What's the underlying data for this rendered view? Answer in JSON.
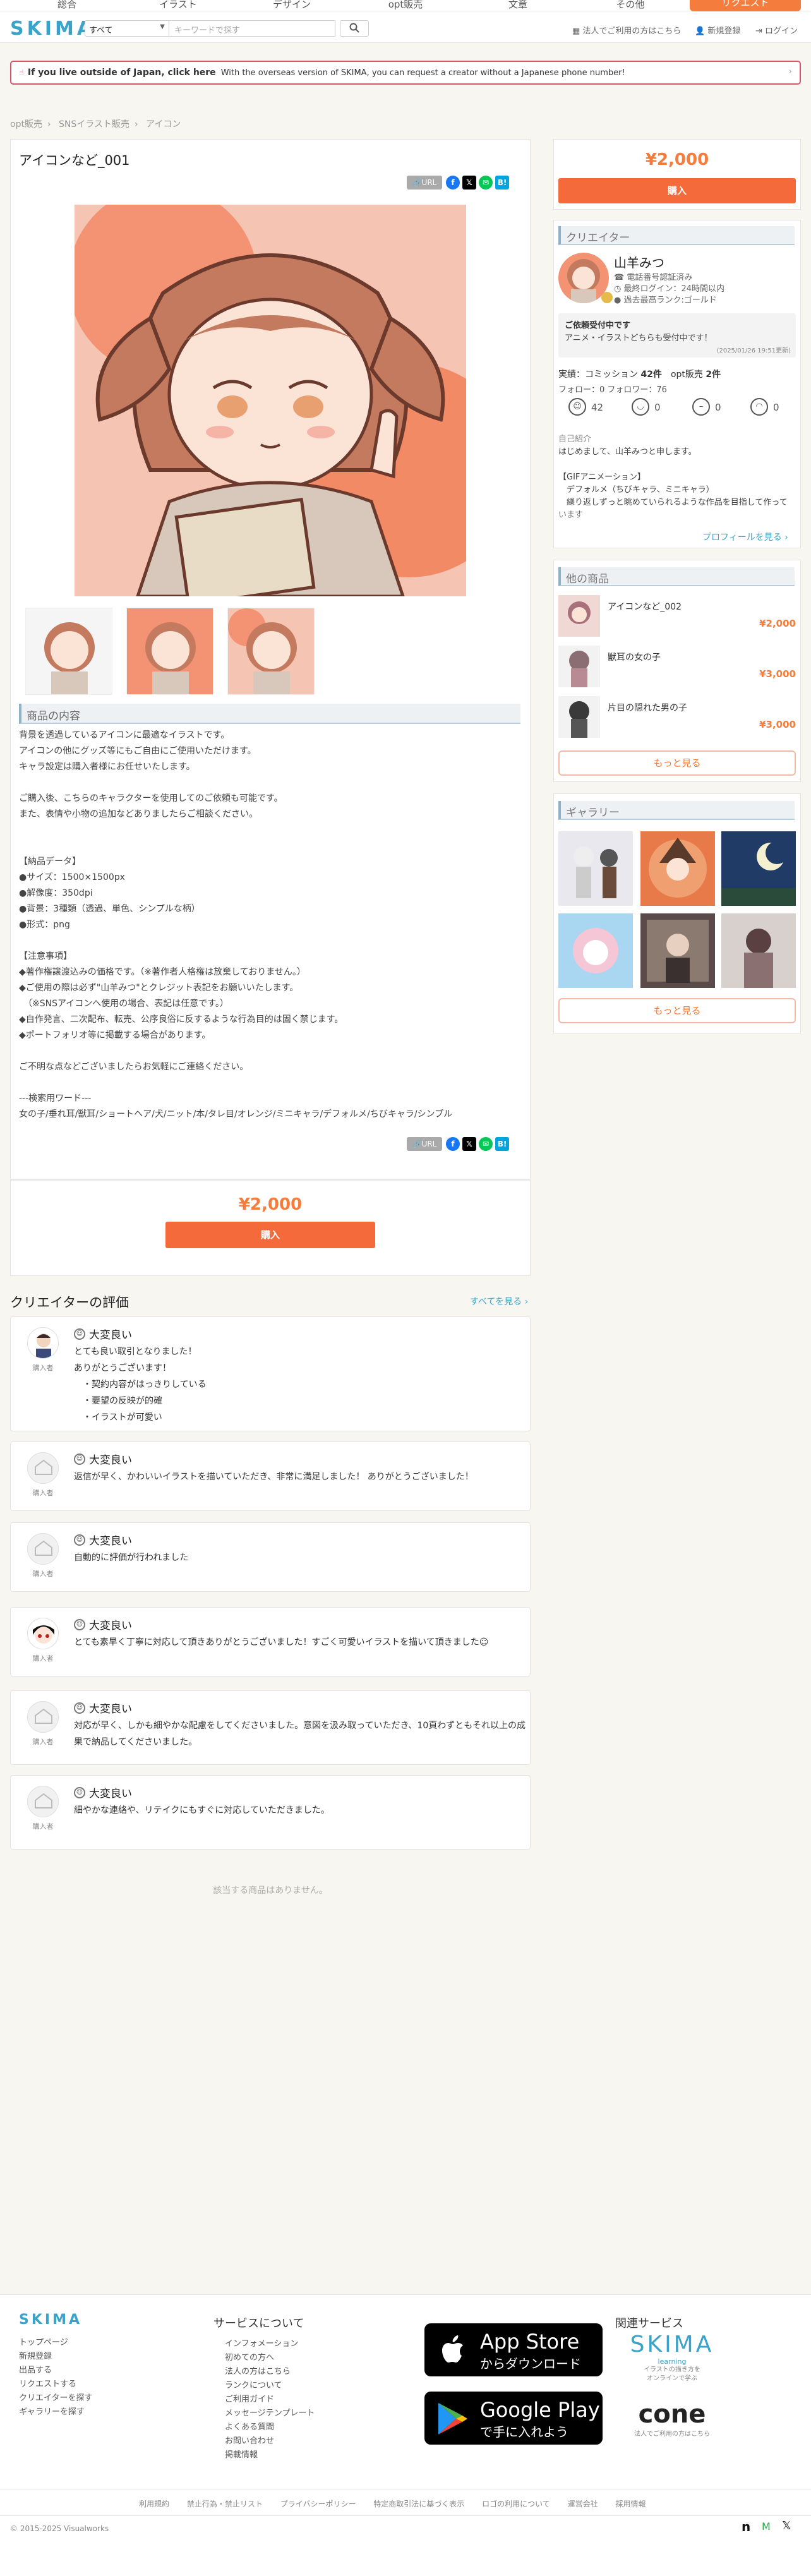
{
  "nav": {
    "items": [
      "総合",
      "イラスト",
      "デザイン",
      "opt販売",
      "文章",
      "その他"
    ],
    "request": "リクエスト"
  },
  "header": {
    "logo": "SKIMA",
    "category": "すべて",
    "search_placeholder": "キーワードで探す",
    "corp_link": "法人でご利用の方はこちら",
    "register": "新規登録",
    "login": "ログイン"
  },
  "banner": {
    "bold": "If you live outside of Japan, click here",
    "text": "With the overseas version of SKIMA, you can request a creator without a Japanese phone number!"
  },
  "breadcrumb": [
    "opt販売",
    "SNSイラスト販売",
    "アイコン"
  ],
  "product": {
    "title": "アイコンなど_001",
    "url_label": "URL",
    "section_title": "商品の内容",
    "description": "背景を透過しているアイコンに最適なイラストです。\nアイコンの他にグッズ等にもご自由にご使用いただけます。\nキャラ設定は購入者様にお任せいたします。\n\nご購入後、こちらのキャラクターを使用してのご依頼も可能です。\nまた、表情や小物の追加などありましたらご相談ください。\n\n\n【納品データ】\n●サイズ：1500×1500px\n●解像度：350dpi\n●背景：3種類（透過、単色、シンプルな柄）\n●形式：png\n\n【注意事項】\n◆著作権譲渡込みの価格です。（※著作者人格権は放棄しておりません。）\n◆ご使用の際は必ず\"山羊みつ\"とクレジット表記をお願いいたします。\n　（※SNSアイコンへ使用の場合、表記は任意です。）\n◆自作発言、二次配布、転売、公序良俗に反するような行為目的は固く禁じます。\n◆ポートフォリオ等に掲載する場合があります。\n\nご不明な点などございましたらお気軽にご連絡ください。\n\n---検索用ワード---\n女の子/垂れ耳/獣耳/ショートヘア/犬/ニット/本/タレ目/オレンジ/ミニキャラ/デフォルメ/ちびキャラ/シンプル",
    "price": "¥2,000",
    "buy": "購入"
  },
  "reviews": {
    "heading": "クリエイターの評価",
    "see_all": "すべてを見る ›",
    "buyer": "購入者",
    "items": [
      {
        "rating": "大変良い",
        "text": "とても良い取引となりました！\nありがとうございます！\n　・契約内容がはっきりしている\n　・要望の反映が的確\n　・イラストが可愛い"
      },
      {
        "rating": "大変良い",
        "text": "返信が早く、かわいいイラストを描いていただき、非常に満足しました！ ありがとうございました！"
      },
      {
        "rating": "大変良い",
        "text": "自動的に評価が行われました"
      },
      {
        "rating": "大変良い",
        "text": "とても素早く丁寧に対応して頂きありがとうございました！すごく可愛いイラストを描いて頂きました☺"
      },
      {
        "rating": "大変良い",
        "text": "対応が早く、しかも細やかな配慮をしてくださいました。意図を汲み取っていただき、10頁わずともそれ以上の成果で納品してくださいました。"
      },
      {
        "rating": "大変良い",
        "text": "細やかな連絡や、リテイクにもすぐに対応していただきました。"
      }
    ],
    "no_more": "該当する商品はありません。"
  },
  "side": {
    "price": "¥2,000",
    "buy": "購入",
    "creator_heading": "クリエイター",
    "creator_name": "山羊みつ",
    "verified": "電話番号認証済み",
    "last_login": "最終ログイン：24時間以内",
    "rank": "過去最高ランク:ゴールド",
    "notice_title": "ご依頼受付中です",
    "notice_text": "アニメ・イラストどちらも受付中です！",
    "notice_date": "(2025/01/26 19:51更新)",
    "stats_label": "実績：コミッション",
    "stats_commission": "42件",
    "stats_opt_label": "opt販売",
    "stats_opt": "2件",
    "follow": "フォロー：0 フォロワー：76",
    "face_counts": [
      "42",
      "0",
      "0",
      "0"
    ],
    "intro_label": "自己紹介",
    "intro": "はじめまして、山羊みつと申します。\n\n【GIFアニメーション】\n　デフォルメ（ちびキャラ、ミニキャラ）\n　繰り返しずっと眺めていられるような作品を目指して作っています",
    "profile_link": "プロフィールを見る ›",
    "other_heading": "他の商品",
    "other_items": [
      {
        "name": "アイコンなど_002",
        "price": "¥2,000"
      },
      {
        "name": "獣耳の女の子",
        "price": "¥3,000"
      },
      {
        "name": "片目の隠れた男の子",
        "price": "¥3,000"
      }
    ],
    "more": "もっと見る",
    "gallery_heading": "ギャラリー",
    "gallery_more": "もっと見る"
  },
  "footer": {
    "logo": "SKIMA",
    "links1": [
      "トップページ",
      "新規登録",
      "出品する",
      "リクエストする",
      "クリエイターを探す",
      "ギャラリーを探す"
    ],
    "about_heading": "サービスについて",
    "links2": [
      "インフォメーション",
      "初めての方へ",
      "法人の方はこちら",
      "ランクについて",
      "ご利用ガイド",
      "メッセージテンプレート",
      "よくある質問",
      "お問い合わせ",
      "掲載情報"
    ],
    "appstore_small": "からダウンロード",
    "appstore_big": "App Store",
    "gplay_big": "Google Play",
    "gplay_small": "で手に入れよう",
    "related_heading": "関連サービス",
    "learning_logo": "SKIMA",
    "learning_sub": "learning",
    "learning_desc": "イラストの描き方を\nオンラインで学ぶ",
    "cone_logo": "cone",
    "cone_desc": "法人でご利用の方はこちら",
    "bottom_links": [
      "利用規約",
      "禁止行為・禁止リスト",
      "プライバシーポリシー",
      "特定商取引法に基づく表示",
      "ロゴの利用について",
      "運営会社",
      "採用情報"
    ],
    "copyright": "© 2015-2025 Visualworks"
  },
  "colors": {
    "accent": "#f47c3c",
    "brand": "#3aa3c9",
    "alert": "#d9536b"
  }
}
